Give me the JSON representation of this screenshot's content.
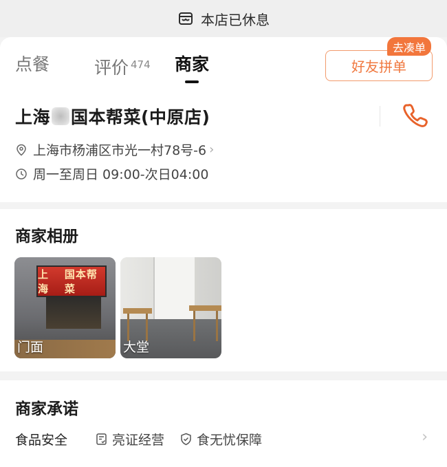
{
  "banner": {
    "text": "本店已休息",
    "icon": "store-icon"
  },
  "tabs": [
    {
      "label": "点餐",
      "active": false
    },
    {
      "label": "评价",
      "count": "474",
      "active": false
    },
    {
      "label": "商家",
      "active": true
    }
  ],
  "group_button": {
    "label": "好友拼单",
    "badge": "去凑单"
  },
  "store": {
    "name_prefix": "上海",
    "name_suffix": "国本帮菜(中原店)",
    "address": "上海市杨浦区市光一村78号-6",
    "hours": "周一至周日 09:00-次日04:00"
  },
  "album": {
    "title": "商家相册",
    "photos": [
      {
        "label": "门面",
        "sign_text_left": "上海",
        "sign_text_right": "国本帮菜"
      },
      {
        "label": "大堂"
      }
    ]
  },
  "promise": {
    "title": "商家承诺",
    "category": "食品安全",
    "items": [
      {
        "label": "亮证经营",
        "icon": "license-icon"
      },
      {
        "label": "食无忧保障",
        "icon": "shield-check-icon"
      }
    ]
  },
  "colors": {
    "accent": "#f0783f",
    "badge": "#f2763c",
    "phone": "#e8622a"
  }
}
